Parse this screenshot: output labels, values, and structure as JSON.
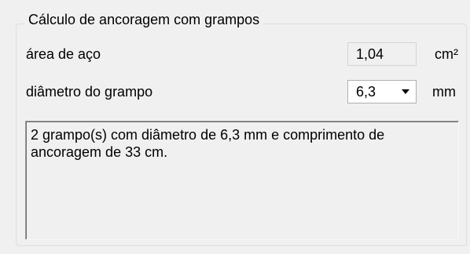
{
  "group": {
    "title": "Cálculo de ancoragem com grampos"
  },
  "area": {
    "label": "área de aço",
    "value": "1,04",
    "unit": "cm²"
  },
  "diameter": {
    "label": "diâmetro do grampo",
    "selected": "6,3",
    "unit": "mm"
  },
  "result": {
    "text": "2 grampo(s) com diâmetro de 6,3 mm e comprimento de ancoragem de 33 cm."
  },
  "icons": {
    "dropdown": "chevron-down-icon"
  }
}
